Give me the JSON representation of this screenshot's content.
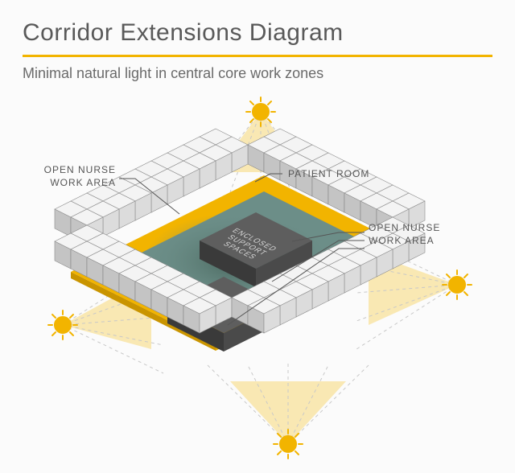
{
  "title": "Corridor Extensions Diagram",
  "subtitle": "Minimal natural light in central core work zones",
  "labels": {
    "nurse_left": "OPEN NURSE\nWORK AREA",
    "patient_room": "PATIENT ROOM",
    "nurse_right": "OPEN NURSE\nWORK AREA",
    "enclosed1": "ENCLOSED\nSUPPORT\nSPACES",
    "enclosed2": "ENCLOSED\nSUPPORT\nSPACES"
  },
  "colors": {
    "accent": "#f2b400",
    "floor": "#6c8e88",
    "floor_shadow": "#3f5c52",
    "box_top": "#f4f4f4",
    "box_left": "#c9c9c9",
    "box_right": "#e0e0e0",
    "core_top": "#5a5a5a",
    "core_left": "#3d3d3d",
    "core_right": "#4c4c4c",
    "sun": "#f2b400"
  }
}
